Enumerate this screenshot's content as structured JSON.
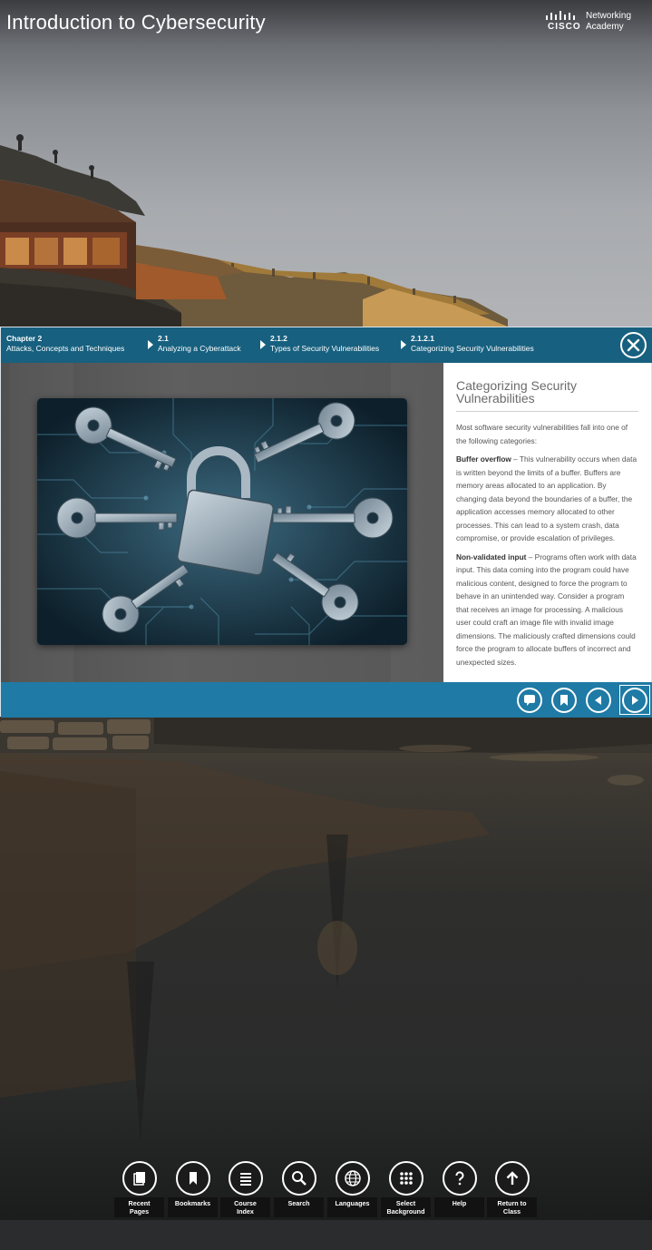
{
  "header": {
    "course_title": "Introduction to Cybersecurity",
    "brand": {
      "word": "CISCO",
      "line1": "Networking",
      "line2": "Academy"
    }
  },
  "breadcrumb": [
    {
      "num": "Chapter 2",
      "label": "Attacks, Concepts and Techniques"
    },
    {
      "num": "2.1",
      "label": "Analyzing a Cyberattack"
    },
    {
      "num": "2.1.2",
      "label": "Types of Security Vulnerabilities"
    },
    {
      "num": "2.1.2.1",
      "label": "Categorizing Security Vulnerabilities"
    }
  ],
  "content": {
    "title": "Categorizing Security Vulnerabilities",
    "intro": "Most software security vulnerabilities fall into one of the following categories:",
    "items": [
      {
        "term": "Buffer overflow",
        "text": " – This vulnerability occurs when data is written beyond the limits of a buffer. Buffers are memory areas allocated to an application. By changing data beyond the boundaries of a buffer, the application accesses memory allocated to other processes. This can lead to a system crash, data compromise, or provide escalation of privileges."
      },
      {
        "term": "Non-validated input",
        "text": " – Programs often work with data input. This data coming into the program could have malicious content, designed to force the program to behave in an unintended way. Consider a program that receives an image for processing. A malicious user could craft an image file with invalid image dimensions. The maliciously crafted dimensions could force the program to allocate buffers of incorrect and unexpected sizes."
      }
    ]
  },
  "nav_icons": [
    "comment-icon",
    "bookmark-icon",
    "previous-icon",
    "next-icon"
  ],
  "toolbar": [
    {
      "label": "Recent\nPages",
      "icon": "recent-pages-icon"
    },
    {
      "label": "Bookmarks",
      "icon": "bookmarks-icon"
    },
    {
      "label": "Course\nIndex",
      "icon": "course-index-icon"
    },
    {
      "label": "Search",
      "icon": "search-icon"
    },
    {
      "label": "Languages",
      "icon": "languages-icon"
    },
    {
      "label": "Select\nBackground",
      "icon": "select-background-icon"
    },
    {
      "label": "Help",
      "icon": "help-icon"
    },
    {
      "label": "Return to\nClass",
      "icon": "return-to-class-icon"
    }
  ],
  "colors": {
    "breadcrumb_bg": "#17607f",
    "nav_bar_bg": "#1f7aa5",
    "accent": "#2a86c4"
  }
}
